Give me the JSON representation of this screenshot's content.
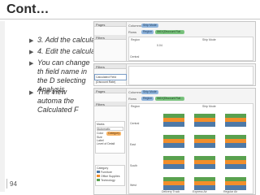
{
  "slide": {
    "title": "Cont…",
    "page_number": "94"
  },
  "bullets": [
    {
      "text": "3. Add the calculation to the view."
    },
    {
      "text": "4. Edit the calculat"
    },
    {
      "text": "You can change th field name in the D selecting Analysis"
    },
    {
      "text": "The view automa the Calculated F"
    }
  ],
  "screenshot": {
    "columns_label": "Columns",
    "rows_label": "Rows",
    "pages_label": "Pages",
    "filters_label": "Filters",
    "marks_label": "Marks",
    "ship_mode_pill": "Ship Mode",
    "region_pill": "Region",
    "measure_pill": "MAX(Discount Rat…",
    "calc_field": "Calculated Field (Discount Rate)",
    "region_header": "Region",
    "ship_mode_header": "Ship Mode",
    "ship_mode_header_short": "Ship Mode",
    "central": "Central",
    "east": "East",
    "south": "South",
    "west": "West",
    "axis_value": "0.04",
    "max_disc": "Max. Discount R…",
    "marks_type": "Automatic",
    "color_label": "Color",
    "size_label": "Size",
    "label_label": "Label",
    "category_pill": "Category",
    "detail_label": "Level of Detail",
    "category_title": "Category",
    "legend": [
      {
        "name": "Furniture",
        "color": "#4e79a7"
      },
      {
        "name": "Office Supplies",
        "color": "#f28e2b"
      },
      {
        "name": "Technology",
        "color": "#59a14f"
      }
    ],
    "x_categories": [
      "Delivery Truck",
      "Express Air",
      "Regular Air"
    ]
  }
}
